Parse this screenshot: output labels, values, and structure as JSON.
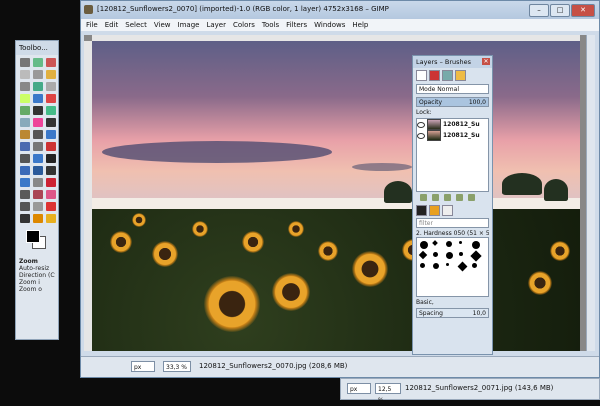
{
  "toolbox": {
    "title": "Toolbo...",
    "tool_colors": [
      "#777",
      "#6b8",
      "#c55",
      "#bbb",
      "#999",
      "#e0b040",
      "#888",
      "#4a8",
      "#aaa",
      "#cf6",
      "#3a78c9",
      "#d44",
      "#6a6",
      "#333",
      "#4b8",
      "#8ab",
      "#e49",
      "#333",
      "#b83",
      "#555",
      "#3a78c9",
      "#4a6ab0",
      "#777",
      "#c33",
      "#555",
      "#3a78c9",
      "#222",
      "#3a6ab8",
      "#2a5a9a",
      "#333",
      "#3a78c9",
      "#888",
      "#c23",
      "#5a5a5a",
      "#a45",
      "#d58",
      "#555",
      "#999",
      "#d33",
      "#333",
      "#d80",
      "#e8b020"
    ],
    "options_title": "Zoom",
    "auto_resize": "Auto-resiz",
    "direction": "Direction (Ct",
    "zoom_in": "Zoom i",
    "zoom_out": "Zoom o"
  },
  "main": {
    "title": "[120812_Sunflowers2_0070] (imported)-1.0 (RGB color, 1 layer) 4752x3168 – GIMP",
    "menu": [
      "File",
      "Edit",
      "Select",
      "View",
      "Image",
      "Layer",
      "Colors",
      "Tools",
      "Filters",
      "Windows",
      "Help"
    ],
    "status": {
      "unit": "px",
      "zoom": "33,3 %",
      "text": "120812_Sunflowers2_0070.jpg (208,6 MB)"
    }
  },
  "layers": {
    "title": "Layers – Brushes",
    "mode_label": "Mode",
    "mode_value": "Normal",
    "opacity_label": "Opacity",
    "opacity_value": "100,0",
    "lock_label": "Lock:",
    "layer_names": [
      "120812_Su",
      "120812_Su"
    ],
    "filter_placeholder": "filter",
    "brush_name": "2. Hardness 050 (51 × 51)",
    "preset": "Basic,",
    "spacing_label": "Spacing",
    "spacing_value": "10,0"
  },
  "second": {
    "unit": "px",
    "zoom": "12,5 %",
    "text": "120812_Sunflowers2_0071.jpg (143,6 MB)"
  }
}
